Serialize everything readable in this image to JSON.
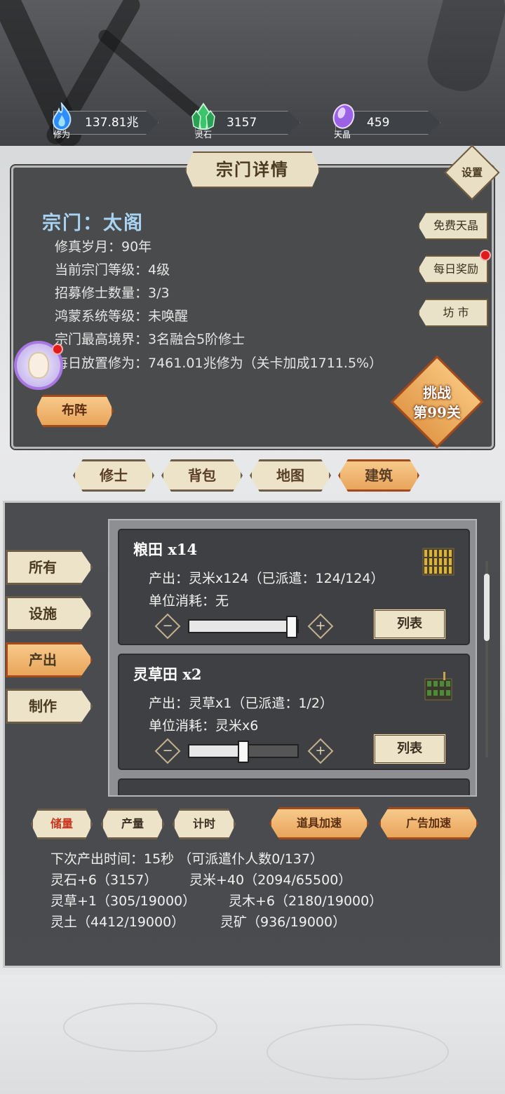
{
  "resources": [
    {
      "name": "修为",
      "value": "137.81兆",
      "icon": "blue-flame-icon",
      "color": "#3fa7ff"
    },
    {
      "name": "灵石",
      "value": "3157",
      "icon": "green-crystal-icon",
      "color": "#3cc46a"
    },
    {
      "name": "天晶",
      "value": "459",
      "icon": "purple-gem-icon",
      "color": "#a06be8"
    }
  ],
  "panel": {
    "title": "宗门详情",
    "settings_label": "设置",
    "sect_name": "宗门：太阁",
    "info": [
      "修真岁月：90年",
      "当前宗门等级：4级",
      "招募修士数量：3/3",
      "鸿蒙系统等级：未唤醒",
      "宗门最高境界：3名融合5阶修士",
      "每日放置修为：7461.01兆修为（关卡加成1711.5%）"
    ],
    "side_buttons": [
      "免费天晶",
      "每日奖励",
      "坊 市"
    ],
    "formation_label": "布阵",
    "challenge_line1": "挑战",
    "challenge_line2": "第99关"
  },
  "main_tabs": [
    {
      "label": "修士",
      "active": false
    },
    {
      "label": "背包",
      "active": false
    },
    {
      "label": "地图",
      "active": false
    },
    {
      "label": "建筑",
      "active": true
    }
  ],
  "categories": [
    {
      "label": "所有",
      "active": false
    },
    {
      "label": "设施",
      "active": false
    },
    {
      "label": "产出",
      "active": true
    },
    {
      "label": "制作",
      "active": false
    }
  ],
  "buildings": [
    {
      "name": "粮田",
      "count": "x14",
      "output": "产出：灵米x124（已派遣：124/124）",
      "cost": "单位消耗：无",
      "assigned_fraction": 1.0,
      "list_label": "列表"
    },
    {
      "name": "灵草田",
      "count": "x2",
      "output": "产出：灵草x1（已派遣：1/2）",
      "cost": "单位消耗：灵米x6",
      "assigned_fraction": 0.5,
      "list_label": "列表"
    }
  ],
  "stepper": {
    "minus": "−",
    "plus": "+"
  },
  "bottom_buttons": {
    "storage": "储量",
    "output": "产量",
    "timer": "计时",
    "item_speed": "道具加速",
    "ad_speed": "广告加速"
  },
  "summary": {
    "next_output": "下次产出时间：15秒 （可派遣仆人数0/137）",
    "line2_a": "灵石+6（3157）",
    "line2_b": "灵米+40（2094/65500）",
    "line3_a": "灵草+1（305/19000）",
    "line3_b": "灵木+6（2180/19000）",
    "line4_a": "灵土（4412/19000）",
    "line4_b": "灵矿（936/19000）"
  }
}
